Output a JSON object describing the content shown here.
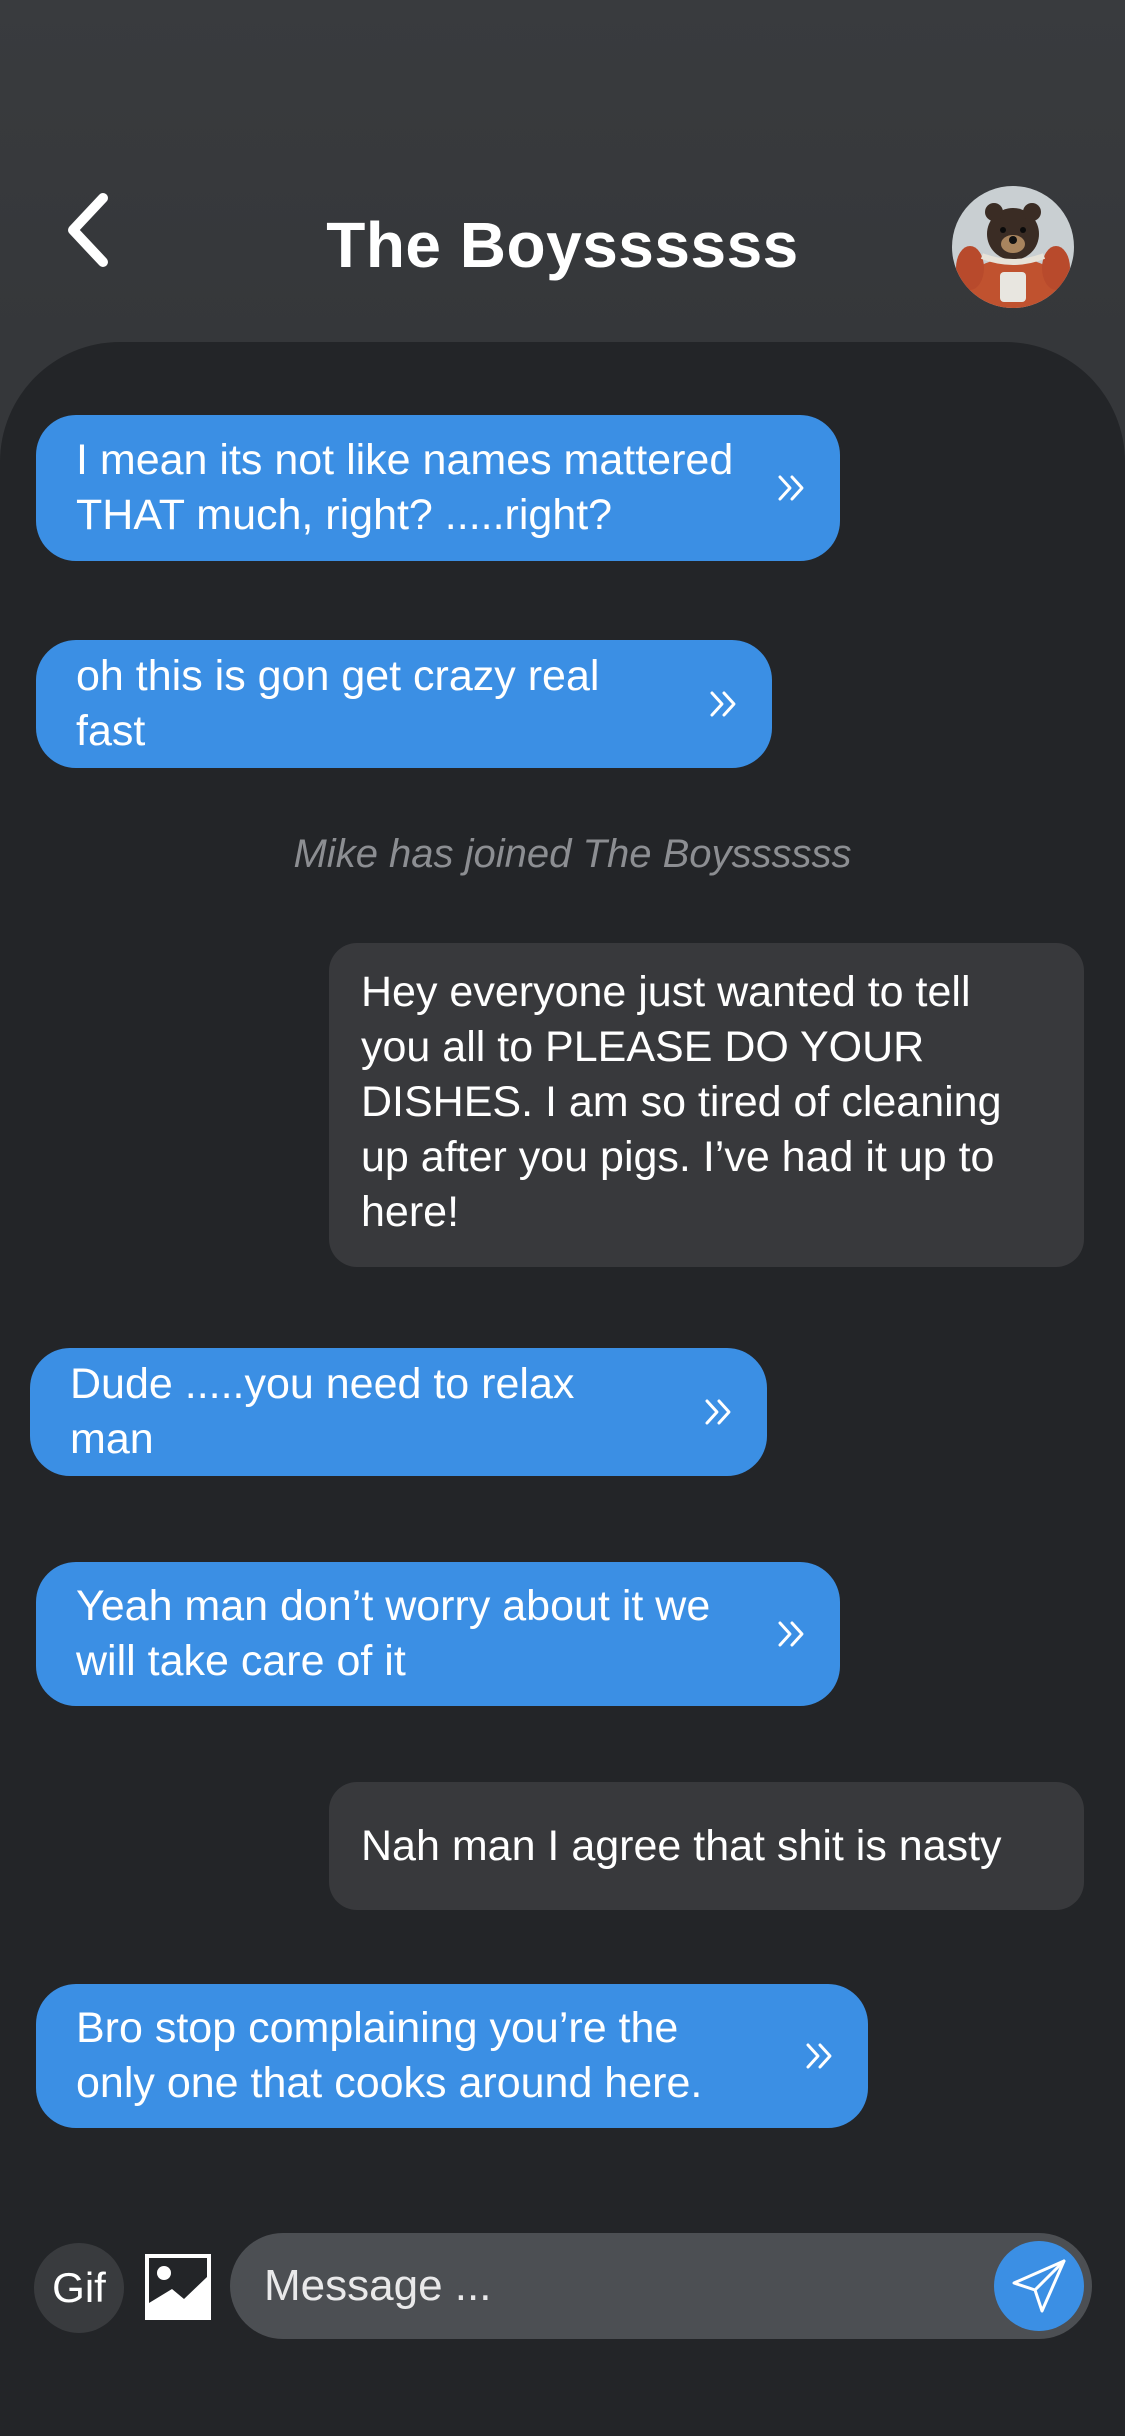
{
  "header": {
    "title": "The Boyssssss",
    "back_icon": "chevron-left-icon",
    "avatar_icon": "group-avatar"
  },
  "messages": [
    {
      "type": "incoming",
      "text": "I mean its not like names mattered THAT much, right? .....right?"
    },
    {
      "type": "incoming",
      "text": "oh this is gon get crazy real fast"
    },
    {
      "type": "system",
      "text": "Mike has joined The Boyssssss"
    },
    {
      "type": "outgoing",
      "text": "Hey everyone just wanted to tell you all to PLEASE DO YOUR DISHES. I am so tired of cleaning up after you pigs. I’ve had it up to here!"
    },
    {
      "type": "incoming",
      "text": "Dude .....you need to relax man"
    },
    {
      "type": "incoming",
      "text": "Yeah man don’t worry about it we will take care of it"
    },
    {
      "type": "outgoing",
      "text": "Nah man I agree that shit is nasty"
    },
    {
      "type": "incoming",
      "text": "Bro stop complaining you’re the only one that cooks around here."
    }
  ],
  "composer": {
    "gif_label": "Gif",
    "image_icon": "image-icon",
    "placeholder": "Message ...",
    "send_icon": "send-icon"
  },
  "colors": {
    "incoming_bubble": "#3b8fe4",
    "outgoing_bubble": "#38393c",
    "chat_background": "#232528",
    "header_background": "#393b3e"
  }
}
